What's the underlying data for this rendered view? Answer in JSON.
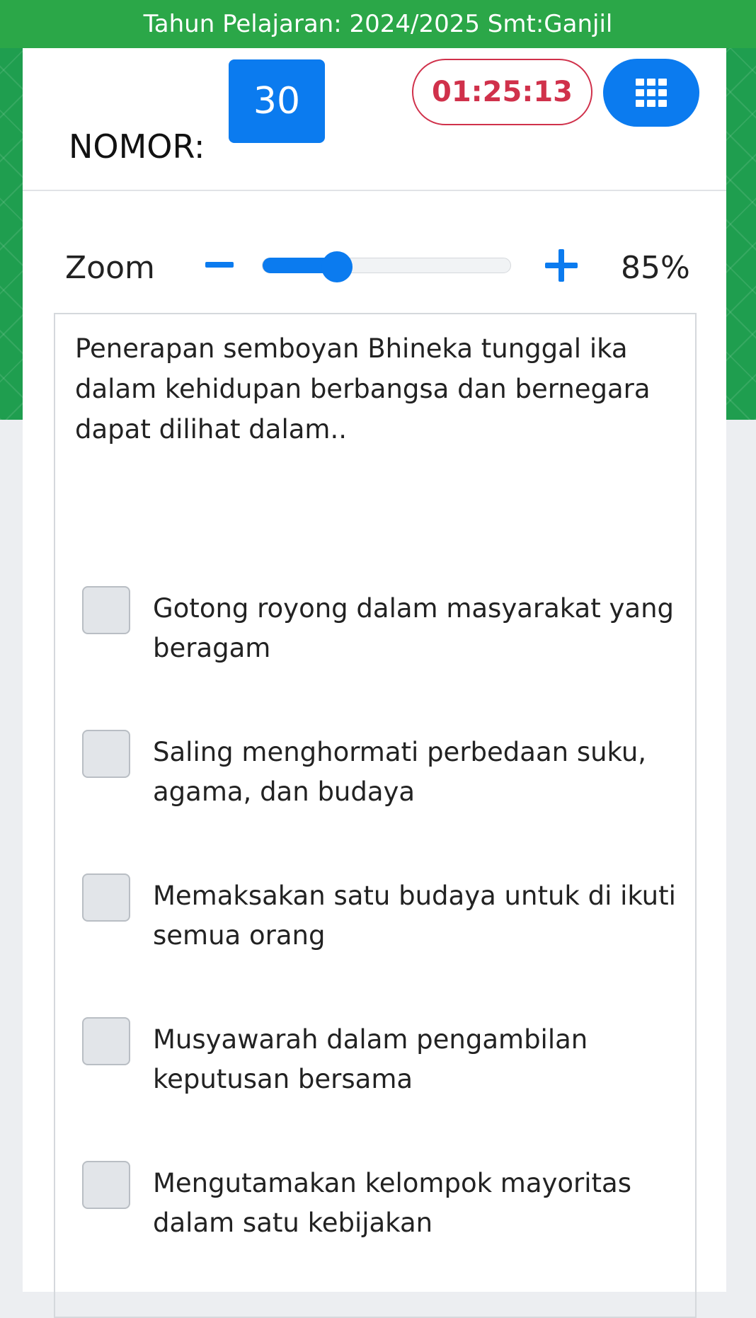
{
  "header": {
    "academic_year": "Tahun Pelajaran: 2024/2025 Smt:Ganjil"
  },
  "exam": {
    "number_label": "NOMOR:",
    "number_value": "30",
    "timer": "01:25:13",
    "grid_icon": "grid-icon"
  },
  "zoom": {
    "label": "Zoom",
    "value_text": "85%",
    "slider_level": 0.3,
    "minus_icon": "minus-icon",
    "plus_icon": "plus-icon"
  },
  "question": {
    "text": "Penerapan semboyan Bhineka tunggal ika dalam kehidupan berbangsa dan bernegara dapat dilihat dalam.."
  },
  "options": [
    {
      "text": "Gotong royong dalam masyarakat yang beragam",
      "checked": false
    },
    {
      "text": "Saling menghormati perbedaan suku, agama, dan budaya",
      "checked": false
    },
    {
      "text": "Memaksakan satu budaya untuk di ikuti semua orang",
      "checked": false
    },
    {
      "text": "Musyawarah dalam pengambilan keputusan bersama",
      "checked": false
    },
    {
      "text": "Mengutamakan kelompok mayoritas dalam satu kebijakan",
      "checked": false
    }
  ],
  "colors": {
    "header_green": "#2ba748",
    "primary_blue": "#0b7bef",
    "timer_red": "#d0314b"
  }
}
